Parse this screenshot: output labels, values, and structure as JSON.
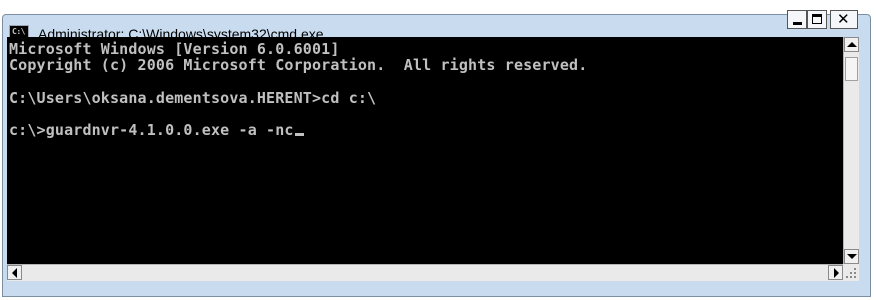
{
  "window": {
    "title": "Administrator: C:\\Windows\\system32\\cmd.exe",
    "icon": "cmd-icon",
    "icon_text": "C:\\"
  },
  "console": {
    "lines": [
      "Microsoft Windows [Version 6.0.6001]",
      "Copyright (c) 2006 Microsoft Corporation.  All rights reserved.",
      "C:\\Users\\oksana.dementsova.HERENT>cd c:\\",
      "c:\\>guardnvr-4.1.0.0.exe -a -nc"
    ],
    "text_color": "#c0c0c0",
    "background_color": "#000000"
  },
  "controls": {
    "minimize_icon": "minimize-icon",
    "maximize_icon": "maximize-icon",
    "close_icon": "close-icon",
    "close_glyph": "✕"
  },
  "colors": {
    "frame": "#c9dcef",
    "frame_border": "#7c8ea3"
  }
}
